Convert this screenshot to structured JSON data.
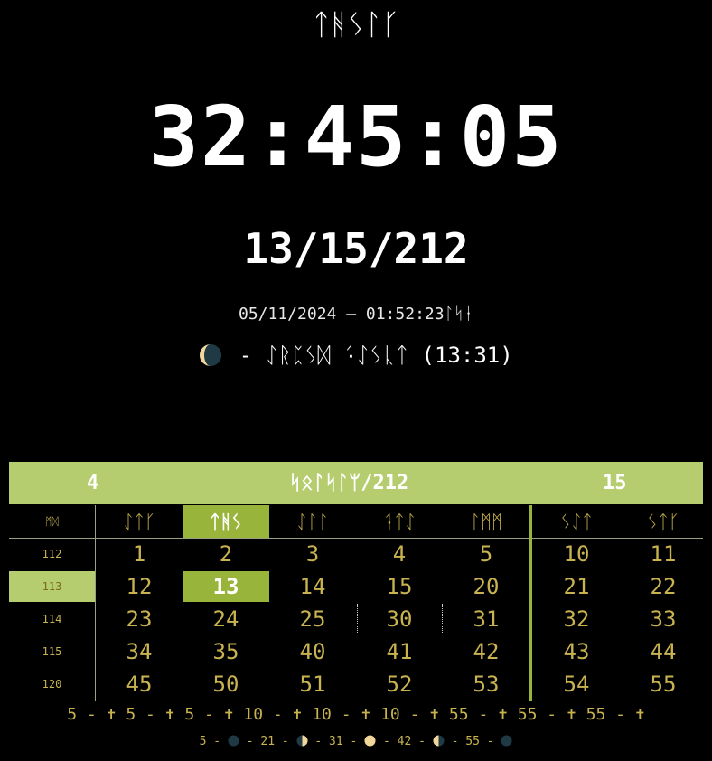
{
  "header": {
    "weekday_title": "ᛏᚻᛊᛚᚴ",
    "time": "32:45:05",
    "date": "13/15/212",
    "earth_datetime": "05/11/2024 — 01:52:23ᛚᛋᛂ",
    "moon_status": "- ᛇᚱᛈᛊᛞ ᛑᛇᛊᚳᛏ (13:31)",
    "moon_icon": "waning-crescent-moon-icon"
  },
  "calendar": {
    "header_left": "4",
    "header_center": "ᛋᛟᛚᛋᛚᛘ/212",
    "header_right": "15",
    "week_col_label": "ᛗᛞ",
    "weekdays": [
      "ᛇᛏᚴ",
      "ᛏᚻᛊ",
      "ᛇᛚᛚ",
      "ᛑᛏᛇ",
      "ᛚᛗᛗ",
      "ᛊᛇᛏ",
      "ᛊᛏᚴ"
    ],
    "today_weekday_index": 1,
    "weeks": [
      {
        "label": "112",
        "days": [
          "1",
          "2",
          "3",
          "4",
          "5",
          "10",
          "11"
        ]
      },
      {
        "label": "113",
        "days": [
          "12",
          "13",
          "14",
          "15",
          "20",
          "21",
          "22"
        ]
      },
      {
        "label": "114",
        "days": [
          "23",
          "24",
          "25",
          "30",
          "31",
          "32",
          "33"
        ]
      },
      {
        "label": "115",
        "days": [
          "34",
          "35",
          "40",
          "41",
          "42",
          "43",
          "44"
        ]
      },
      {
        "label": "120",
        "days": [
          "45",
          "50",
          "51",
          "52",
          "53",
          "54",
          "55"
        ]
      }
    ],
    "current_week_index": 1,
    "today_day": "13"
  },
  "holidays_line": "5 - ✝ 5 - ✝ 5 - ✝ 10 - ✝ 10 - ✝ 10 - ✝ 55 - ✝ 55 - ✝ 55 - ✝",
  "phases": [
    {
      "day": "5",
      "icon": "new-moon-icon"
    },
    {
      "day": "21",
      "icon": "first-quarter-moon-icon"
    },
    {
      "day": "31",
      "icon": "full-moon-icon"
    },
    {
      "day": "42",
      "icon": "last-quarter-moon-icon"
    },
    {
      "day": "55",
      "icon": "new-moon-icon"
    }
  ],
  "colors": {
    "accent_light": "#b5cd6e",
    "accent_dark": "#99b43a",
    "text_gold": "#c8b350"
  }
}
